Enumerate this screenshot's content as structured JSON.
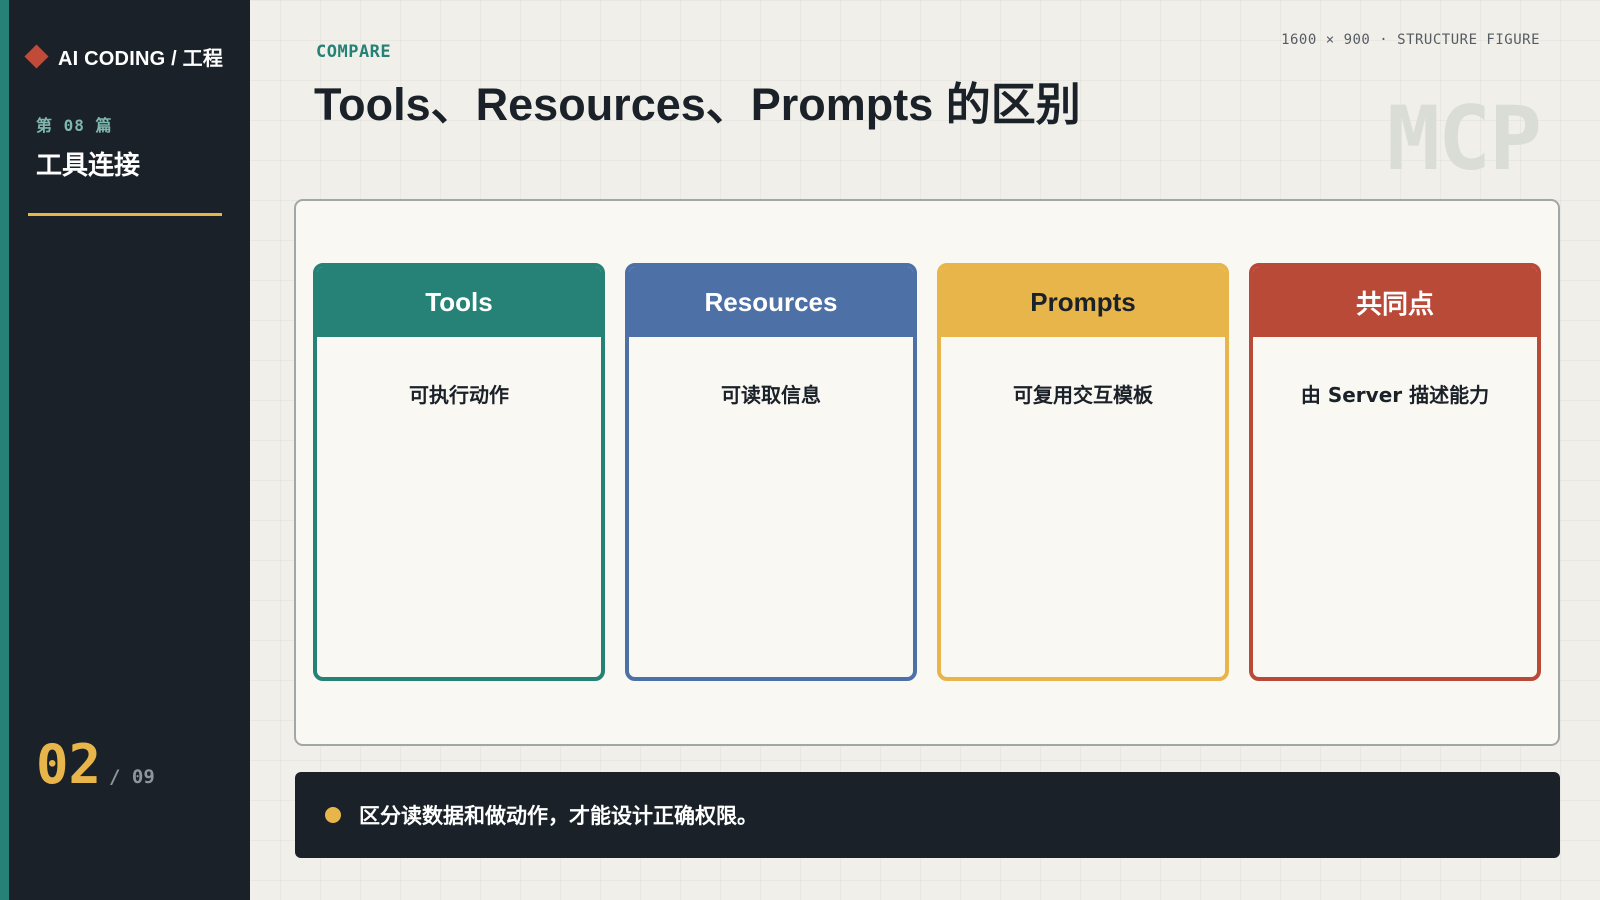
{
  "sidebar": {
    "brand": "AI CODING / 工程",
    "chapter_label": "第 08 篇",
    "chapter_title": "工具连接",
    "page_current": "02",
    "page_total": "/ 09",
    "accent_color": "#268176",
    "divider_color": "#e8b54b"
  },
  "header": {
    "eyebrow": "COMPARE",
    "title": "Tools、Resources、Prompts 的区别",
    "meta": "1600 × 900 · STRUCTURE FIGURE",
    "watermark": "MCP"
  },
  "cards": [
    {
      "title": "Tools",
      "body": "可执行动作",
      "color": "#268176",
      "title_color": "#ffffff"
    },
    {
      "title": "Resources",
      "body": "可读取信息",
      "color": "#4d70a6",
      "title_color": "#ffffff"
    },
    {
      "title": "Prompts",
      "body": "可复用交互模板",
      "color": "#e8b54b",
      "title_color": "#1b2128"
    },
    {
      "title": "共同点",
      "body": "由 Server 描述能力",
      "color": "#b94a38",
      "title_color": "#ffffff"
    }
  ],
  "note": {
    "text": "区分读数据和做动作，才能设计正确权限。",
    "dot_color": "#e8b54b"
  }
}
